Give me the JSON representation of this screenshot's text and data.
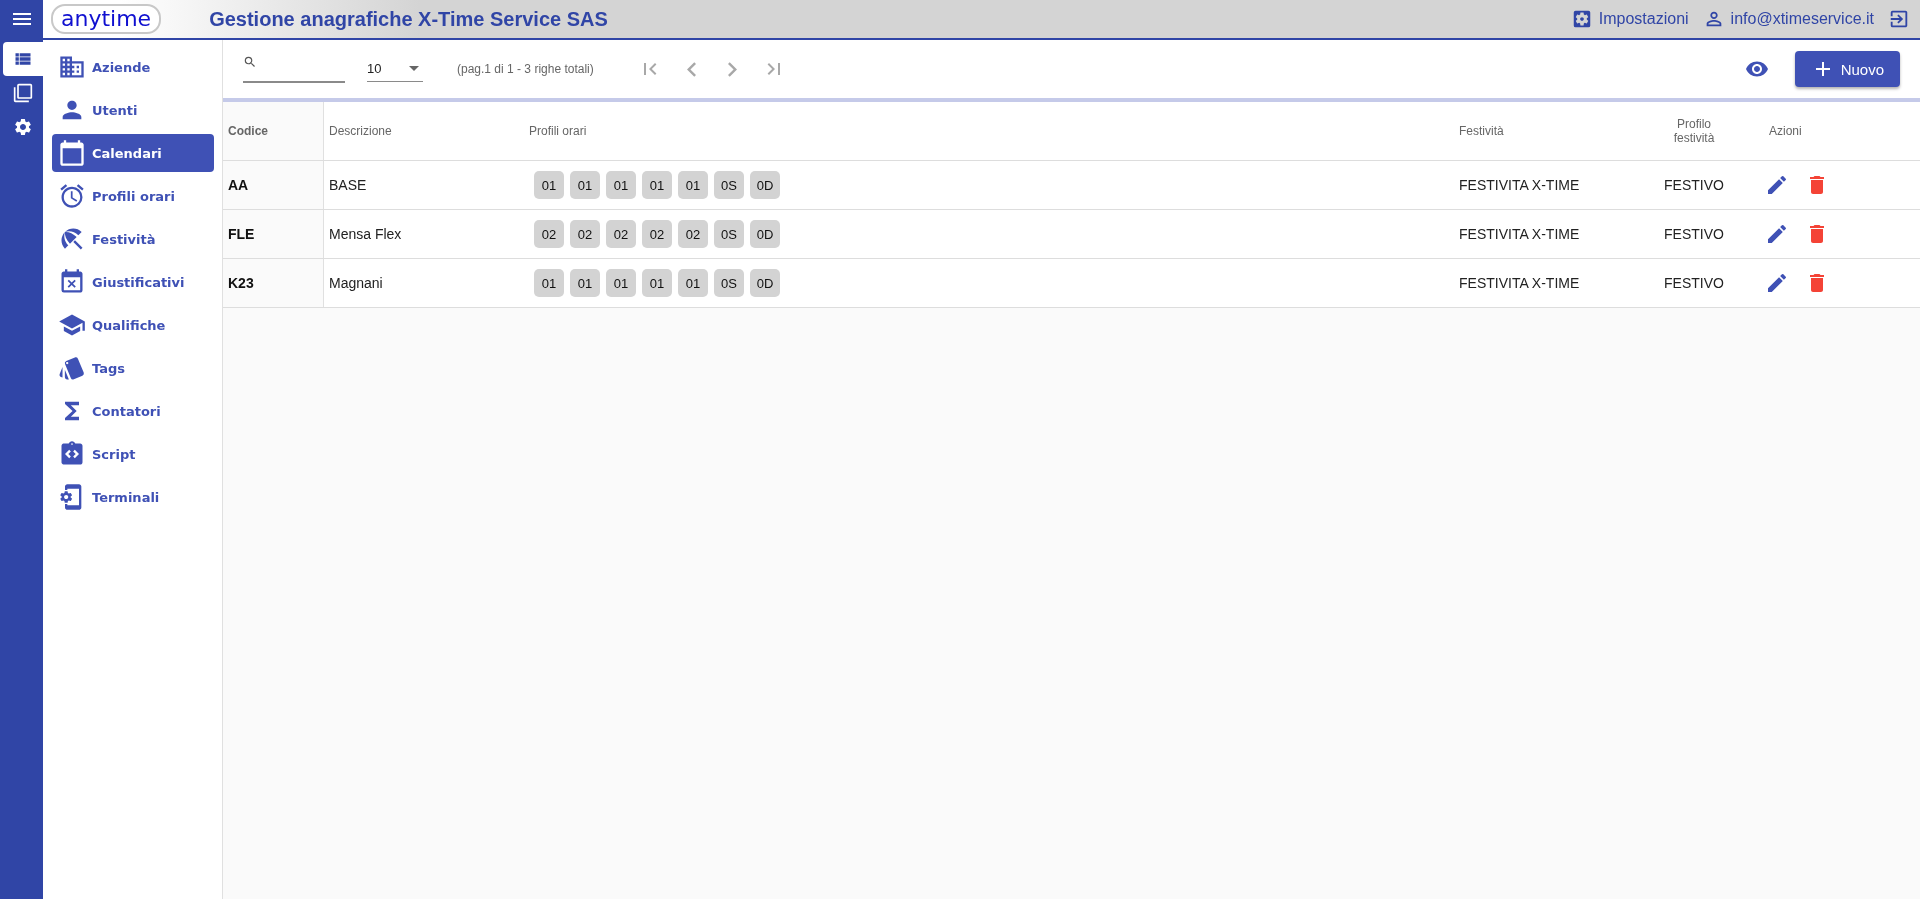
{
  "header": {
    "logo": "anytime",
    "title": "Gestione anagrafiche X-Time Service SAS",
    "settings": "Impostazioni",
    "user": "info@xtimeservice.it"
  },
  "rail": [
    {
      "kind": "list",
      "selected": true
    },
    {
      "kind": "layers",
      "selected": false
    },
    {
      "kind": "settings",
      "selected": false
    }
  ],
  "sidebar": {
    "items": [
      {
        "label": "Aziende",
        "kind": "building",
        "selected": false
      },
      {
        "label": "Utenti",
        "kind": "person",
        "selected": false
      },
      {
        "label": "Calendari",
        "kind": "calendar",
        "selected": true
      },
      {
        "label": "Profili orari",
        "kind": "alarm",
        "selected": false
      },
      {
        "label": "Festività",
        "kind": "umbrella",
        "selected": false
      },
      {
        "label": "Giustificativi",
        "kind": "event-x",
        "selected": false
      },
      {
        "label": "Qualifiche",
        "kind": "school",
        "selected": false
      },
      {
        "label": "Tags",
        "kind": "tags",
        "selected": false
      },
      {
        "label": "Contatori",
        "kind": "sigma",
        "selected": false
      },
      {
        "label": "Script",
        "kind": "code",
        "selected": false
      },
      {
        "label": "Terminali",
        "kind": "device",
        "selected": false
      }
    ]
  },
  "toolbar": {
    "page_size": "10",
    "page_info": "(pag.1 di 1 - 3 righe totali)",
    "new_button": "Nuovo"
  },
  "table": {
    "columns": [
      "Codice",
      "Descrizione",
      "Profili orari",
      "Festività",
      "Profilo festività",
      "Azioni"
    ],
    "rows": [
      {
        "code": "AA",
        "description": "BASE",
        "profiles": [
          "01",
          "01",
          "01",
          "01",
          "01",
          "0S",
          "0D"
        ],
        "holiday": "FESTIVITA X-TIME",
        "holiday_profile": "FESTIVO"
      },
      {
        "code": "FLE",
        "description": "Mensa Flex",
        "profiles": [
          "02",
          "02",
          "02",
          "02",
          "02",
          "0S",
          "0D"
        ],
        "holiday": "FESTIVITA X-TIME",
        "holiday_profile": "FESTIVO"
      },
      {
        "code": "K23",
        "description": "Magnani",
        "profiles": [
          "01",
          "01",
          "01",
          "01",
          "01",
          "0S",
          "0D"
        ],
        "holiday": "FESTIVITA X-TIME",
        "holiday_profile": "FESTIVO"
      }
    ]
  }
}
